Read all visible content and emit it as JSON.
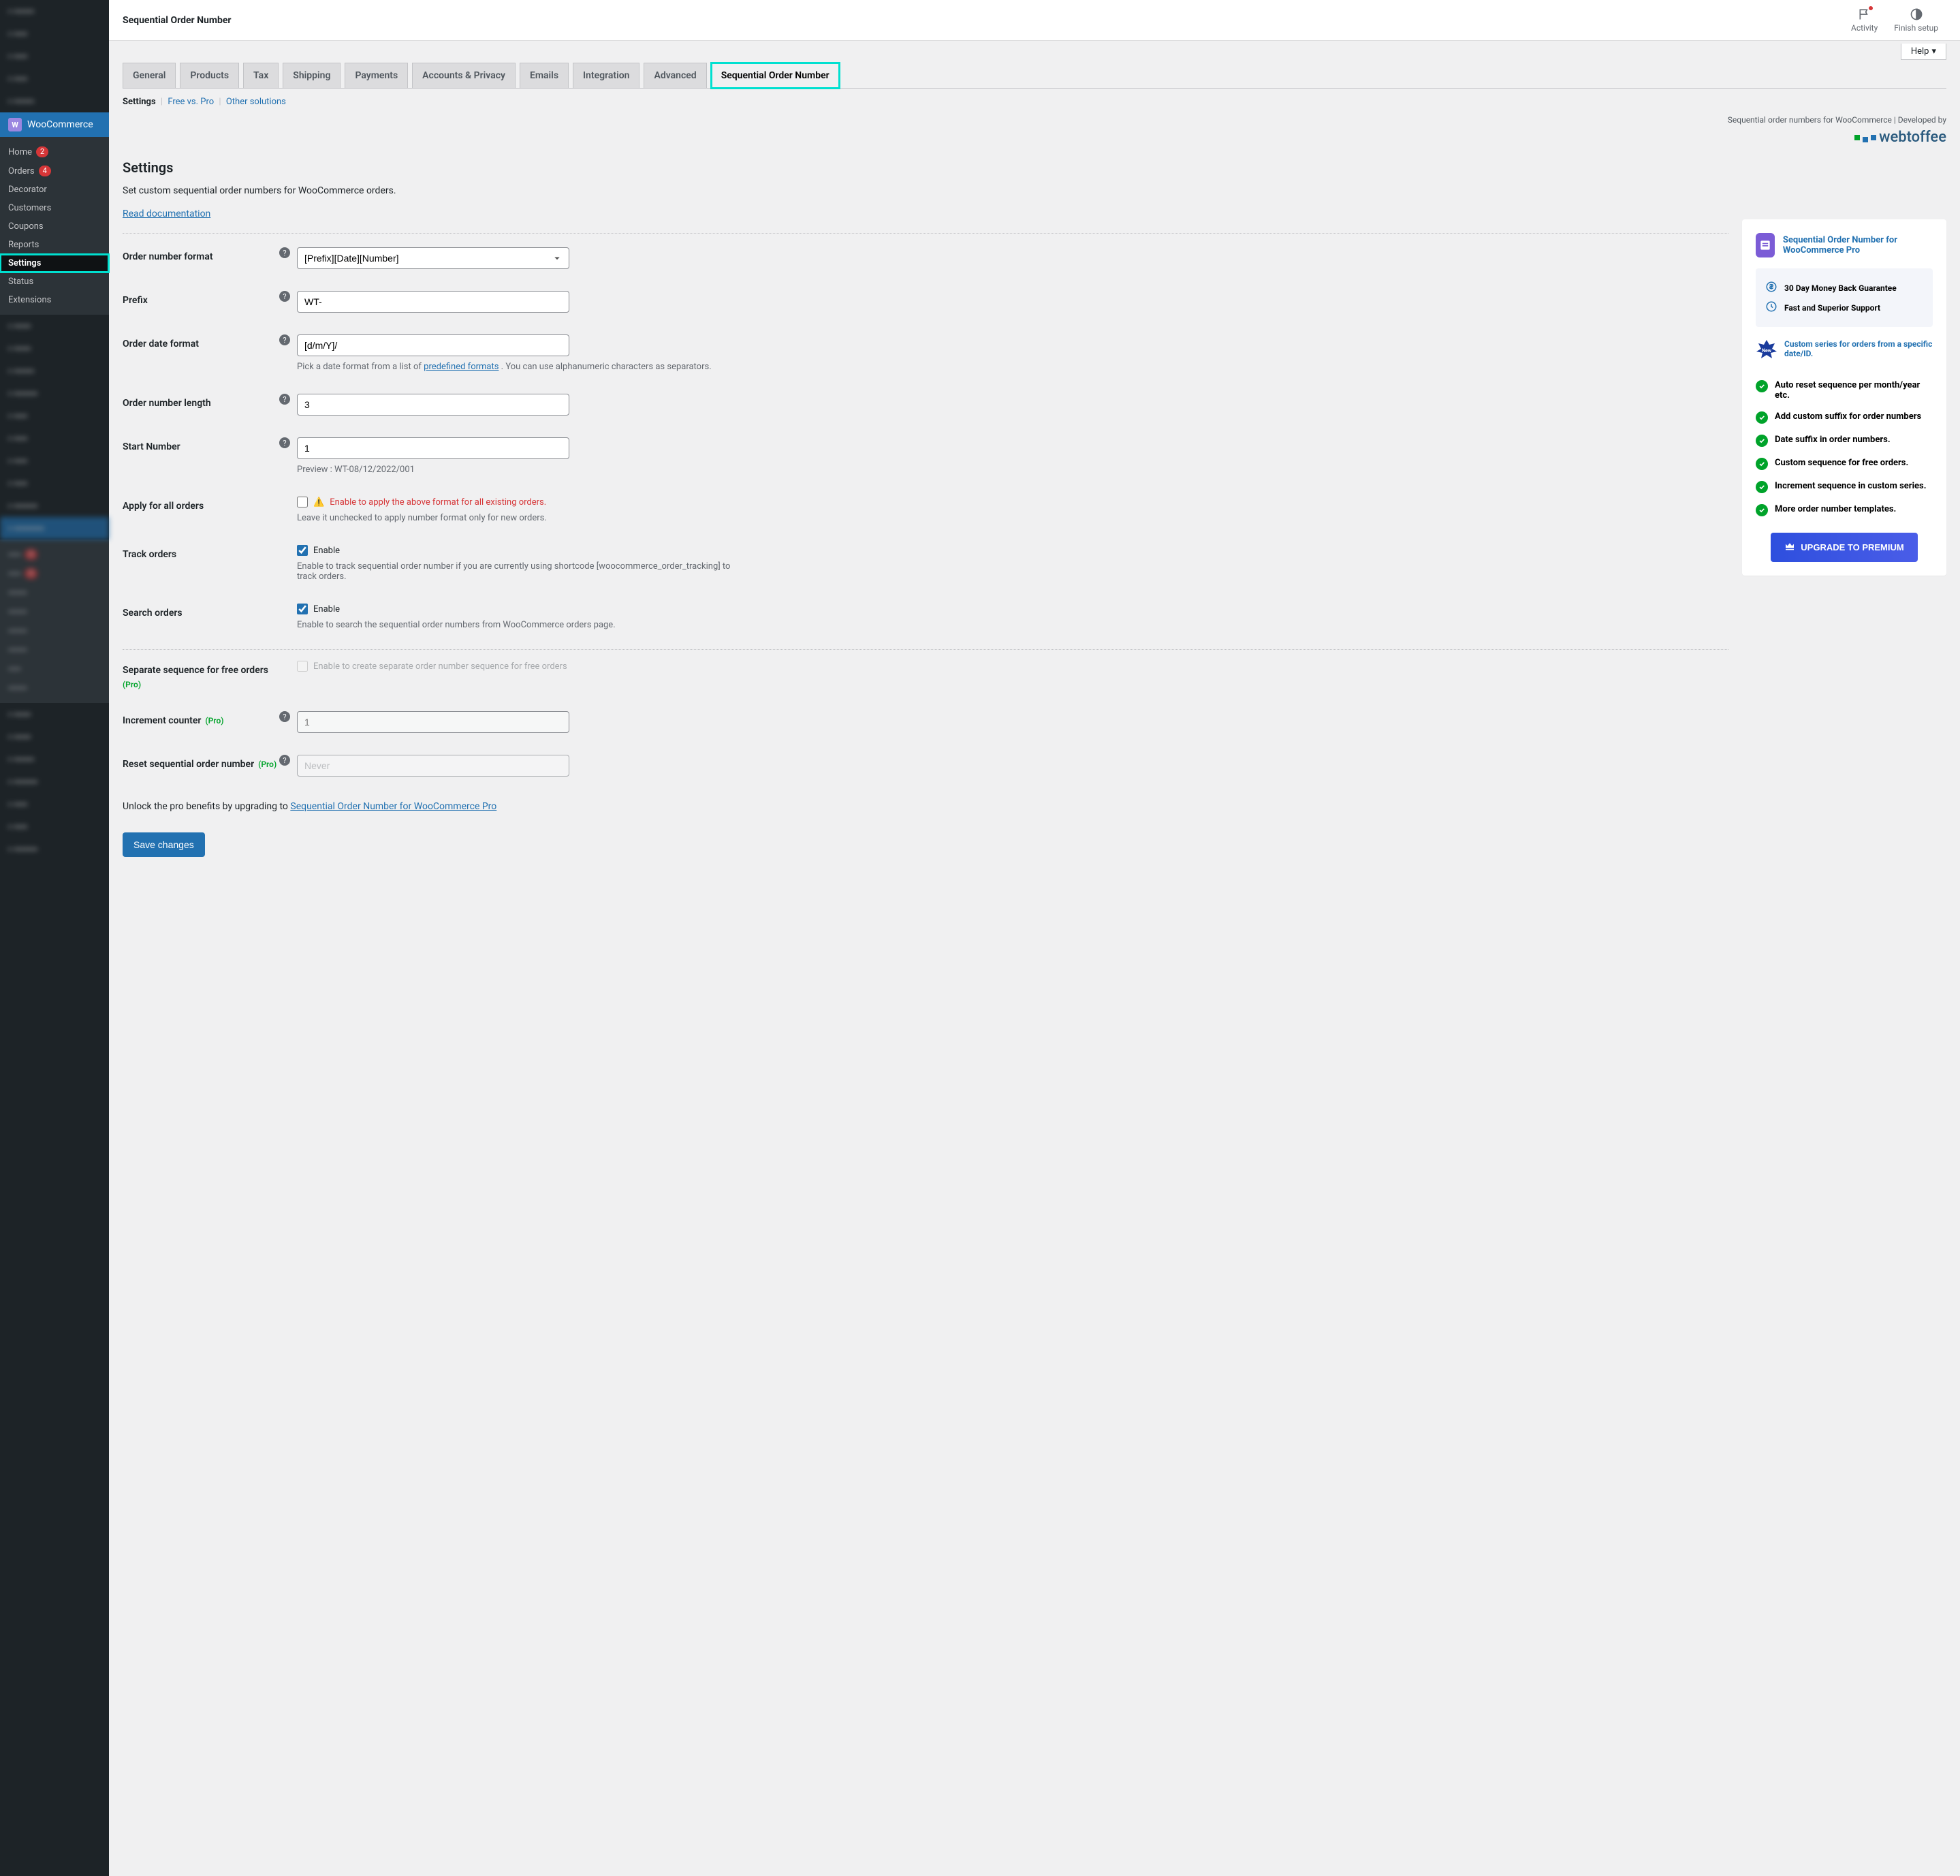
{
  "topbar": {
    "title": "Sequential Order Number",
    "activity": "Activity",
    "finish_setup": "Finish setup",
    "help": "Help"
  },
  "sidebar": {
    "woocommerce": "WooCommerce",
    "home": "Home",
    "home_badge": "2",
    "orders": "Orders",
    "orders_badge": "4",
    "decorator": "Decorator",
    "customers": "Customers",
    "coupons": "Coupons",
    "reports": "Reports",
    "settings": "Settings",
    "status": "Status",
    "extensions": "Extensions"
  },
  "tabs": {
    "general": "General",
    "products": "Products",
    "tax": "Tax",
    "shipping": "Shipping",
    "payments": "Payments",
    "accounts": "Accounts & Privacy",
    "emails": "Emails",
    "integration": "Integration",
    "advanced": "Advanced",
    "sequential": "Sequential Order Number"
  },
  "subnav": {
    "settings": "Settings",
    "free_vs_pro": "Free vs. Pro",
    "other_solutions": "Other solutions"
  },
  "credit": {
    "text": "Sequential order numbers for WooCommerce | Developed by",
    "logo": "webtoffee"
  },
  "settings": {
    "heading": "Settings",
    "description": "Set custom sequential order numbers for WooCommerce orders.",
    "read_doc": "Read documentation"
  },
  "form": {
    "format_label": "Order number format",
    "format_value": "[Prefix][Date][Number]",
    "prefix_label": "Prefix",
    "prefix_value": "WT-",
    "dateformat_label": "Order date format",
    "dateformat_value": "[d/m/Y]/",
    "dateformat_help_pre": "Pick a date format from a list of ",
    "dateformat_help_link": "predefined formats",
    "dateformat_help_post": " . You can use alphanumeric characters as separators.",
    "length_label": "Order number length",
    "length_value": "3",
    "start_label": "Start Number",
    "start_value": "1",
    "preview": "Preview : WT-08/12/2022/001",
    "apply_all_label": "Apply for all orders",
    "apply_all_text": "Enable to apply the above format for all existing orders.",
    "apply_all_help": "Leave it unchecked to apply number format only for new orders.",
    "warn_icon": "⚠️",
    "track_label": "Track orders",
    "track_enable": "Enable",
    "track_help": "Enable to track sequential order number if you are currently using shortcode [woocommerce_order_tracking] to track orders.",
    "search_label": "Search orders",
    "search_enable": "Enable",
    "search_help": "Enable to search the sequential order numbers from WooCommerce orders page.",
    "freeseq_label": "Separate sequence for free orders",
    "freeseq_text": "Enable to create separate order number sequence for free orders",
    "increment_label": "Increment counter",
    "increment_placeholder": "1",
    "reset_label": "Reset sequential order number",
    "reset_placeholder": "Never",
    "pro": "(Pro)",
    "unlock_pre": "Unlock the pro benefits by upgrading to ",
    "unlock_link": "Sequential Order Number for WooCommerce Pro",
    "save": "Save changes"
  },
  "promo": {
    "title": "Sequential Order Number for WooCommerce Pro",
    "guarantee1": "30 Day Money Back Guarantee",
    "guarantee2": "Fast and Superior Support",
    "new_feature": "Custom series for orders from a specific date/ID.",
    "new_label": "New",
    "f1": "Auto reset sequence per month/year etc.",
    "f2": "Add custom suffix for order numbers",
    "f3": "Date suffix in order numbers.",
    "f4": "Custom sequence for free orders.",
    "f5": "Increment sequence in custom series.",
    "f6": "More order number templates.",
    "upgrade": "UPGRADE TO PREMIUM"
  }
}
